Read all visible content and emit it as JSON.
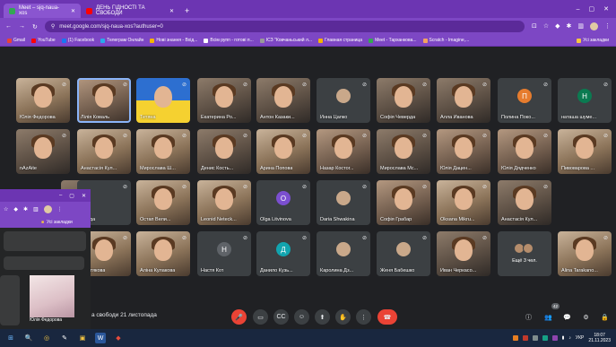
{
  "browser": {
    "tabs": [
      {
        "label": "Meet – sjq-naua-xos",
        "active": true,
        "favicon_color": "#34a853"
      },
      {
        "label": "ДЕНЬ ГІДНОСТІ ТА СВОБОДИ",
        "active": false,
        "favicon_color": "#ff0000"
      }
    ],
    "new_tab": "+",
    "window_controls": [
      "–",
      "▢",
      "✕"
    ],
    "url": "meet.google.com/sjq-naua-xos?authuser=0",
    "bookmarks": [
      {
        "label": "Gmail",
        "color": "#ea4335"
      },
      {
        "label": "YouTube",
        "color": "#ff0000"
      },
      {
        "label": "(1) Facebook",
        "color": "#1877f2"
      },
      {
        "label": "Телеграм Онлайн",
        "color": "#29a9eb"
      },
      {
        "label": "Нові знання - Вхід...",
        "color": "#f4b400"
      },
      {
        "label": "Всім рупп - готові п...",
        "color": "#ffffff"
      },
      {
        "label": "ІСЗ \"Ковчаньський л...",
        "color": "#999999"
      },
      {
        "label": "Главная страница",
        "color": "#f4b400"
      },
      {
        "label": "Meet - Тарханкова...",
        "color": "#34a853"
      },
      {
        "label": "Scratch - Imagine,...",
        "color": "#f4a261"
      }
    ],
    "all_bookmarks": "Усі закладки"
  },
  "meet": {
    "tiles": [
      {
        "name": "Юлія Федорова",
        "style": "cam2"
      },
      {
        "name": "Лілія Коваль",
        "style": "cam3",
        "active": true
      },
      {
        "name": "Тетяна",
        "style": "flag"
      },
      {
        "name": "Екатерина Ро...",
        "style": "cam"
      },
      {
        "name": "Антон Казаки...",
        "style": "cam"
      },
      {
        "name": "Инна Цапко",
        "style": "avatar"
      },
      {
        "name": "Софія Чевердa",
        "style": "cam"
      },
      {
        "name": "Алла Иванова",
        "style": "cam"
      },
      {
        "name": "Полина Поко...",
        "style": "initial",
        "initial": "П",
        "color": "#e67c2e"
      },
      {
        "name": "наташа шуме...",
        "style": "initial",
        "initial": "Н",
        "color": "#0b7a51"
      },
      {
        "name": "nAzAite",
        "style": "cam"
      },
      {
        "name": "Анастасія Кул...",
        "style": "cam2"
      },
      {
        "name": "Мирослава Ш...",
        "style": "cam2"
      },
      {
        "name": "Денис Кость...",
        "style": "cam"
      },
      {
        "name": "Арина Попова",
        "style": "cam2"
      },
      {
        "name": "Назар Костог...",
        "style": "cam3"
      },
      {
        "name": "Мирослава Мс...",
        "style": "cam"
      },
      {
        "name": "Юлія Дацен...",
        "style": "cam3"
      },
      {
        "name": "Юлія Дядченко",
        "style": "cam3"
      },
      {
        "name": "Пивоварова ...",
        "style": "cam2"
      },
      {
        "name": "...ліна Ріу",
        "style": "cam"
      },
      {
        "name": "Влада",
        "style": "blank"
      },
      {
        "name": "Остап Вели...",
        "style": "cam2"
      },
      {
        "name": "Leonid Neteck...",
        "style": "cam2"
      },
      {
        "name": "Olga Litvinova",
        "style": "initial",
        "initial": "O",
        "color": "#7b4fd0"
      },
      {
        "name": "Daria Shwakina",
        "style": "avatar"
      },
      {
        "name": "Софія Грабар",
        "style": "cam3"
      },
      {
        "name": "Oksana Mikru...",
        "style": "cam2"
      },
      {
        "name": "Анастасія Кул...",
        "style": "cam"
      },
      {
        "name": "...Тетякова",
        "style": "cam2"
      },
      {
        "name": "Аліна Кулакова",
        "style": "cam2"
      },
      {
        "name": "Настя Кот",
        "style": "initial",
        "initial": "Н",
        "color": "#5f6368"
      },
      {
        "name": "Данило Кузь...",
        "style": "initial",
        "initial": "Д",
        "color": "#12a4af"
      },
      {
        "name": "Каролина Дз...",
        "style": "avatar"
      },
      {
        "name": "Женя Бабешко",
        "style": "avatar"
      },
      {
        "name": "Иван Черкасо...",
        "style": "cam"
      },
      {
        "name": "Ещё 3 чел.",
        "style": "more"
      },
      {
        "name": "Alina Tarakano...",
        "style": "cam2"
      }
    ],
    "meeting_title": "а свободи 21 листопада",
    "participants_badge": "42",
    "controls": {
      "mic": "🎤",
      "camera": "▭",
      "captions": "CC",
      "emoji": "☺",
      "present": "⬆",
      "raise_hand": "✋",
      "more": "⋮",
      "end_call": "☎",
      "info": "ⓘ",
      "people": "👥",
      "chat": "💬",
      "activities": "⚙",
      "host": "🔒"
    }
  },
  "overlay_window": {
    "window_controls": [
      "–",
      "▢",
      "✕"
    ],
    "all_bookmarks": "Усі закладки",
    "caption": "Юлія Федорова"
  },
  "taskbar": {
    "apps": [
      "⊞",
      "🔍",
      "◎",
      "✎",
      "▣",
      "W",
      "◆"
    ],
    "language": "УКР",
    "time": "18:07",
    "date": "21.11.2023"
  }
}
